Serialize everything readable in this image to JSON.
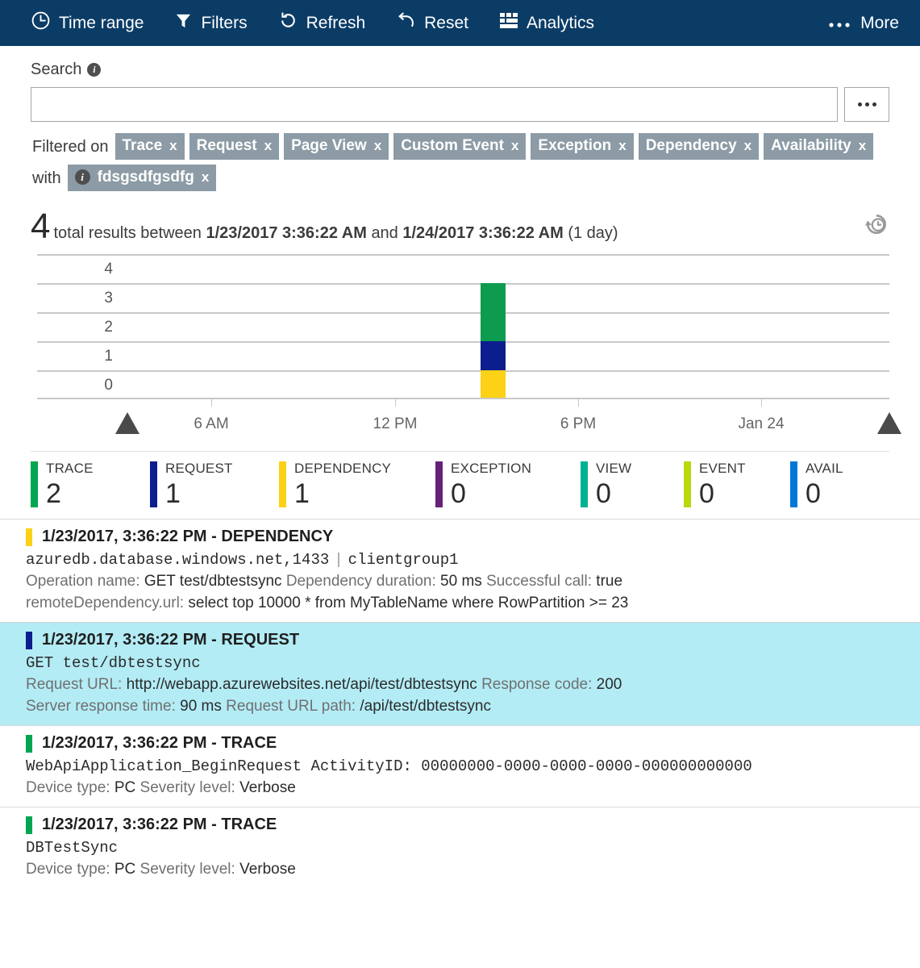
{
  "toolbar": {
    "items": [
      {
        "label": "Time range",
        "icon": "clock-icon"
      },
      {
        "label": "Filters",
        "icon": "funnel-icon"
      },
      {
        "label": "Refresh",
        "icon": "refresh-icon"
      },
      {
        "label": "Reset",
        "icon": "reset-icon"
      },
      {
        "label": "Analytics",
        "icon": "analytics-grid-icon"
      }
    ],
    "more_label": "More",
    "background": "#0B3C66"
  },
  "search": {
    "label": "Search",
    "info_glyph": "i",
    "value": "",
    "placeholder": "",
    "more_button": "..."
  },
  "filters": {
    "prefix": "Filtered on",
    "conjunction": "with",
    "chips": [
      {
        "label": "Trace",
        "x": "x"
      },
      {
        "label": "Request",
        "x": "x"
      },
      {
        "label": "Page View",
        "x": "x"
      },
      {
        "label": "Custom Event",
        "x": "x"
      },
      {
        "label": "Exception",
        "x": "x"
      },
      {
        "label": "Dependency",
        "x": "x"
      },
      {
        "label": "Availability",
        "x": "x"
      }
    ],
    "term_chip": {
      "label": "fdsgsdfgsdfg",
      "x": "x",
      "info_glyph": "i"
    },
    "chip_color": "#8C9BA5"
  },
  "summary": {
    "count": "4",
    "text_before": "total results between",
    "start": "1/23/2017 3:36:22 AM",
    "text_middle": "and",
    "end": "1/24/2017 3:36:22 AM",
    "duration": "(1 day)",
    "history_icon": "history-clock-icon"
  },
  "chart_data": {
    "type": "bar",
    "title": "",
    "xlabel": "",
    "ylabel": "",
    "ylim": [
      0,
      4
    ],
    "yticks": [
      "0",
      "1",
      "2",
      "3",
      "4"
    ],
    "grid": true,
    "legend": "bottom",
    "xticks": [
      "6 AM",
      "12 PM",
      "6 PM",
      "Jan 24"
    ],
    "x_range_start": "1/23/2017 3:36:22 AM",
    "x_range_end": "1/24/2017 3:36:22 AM",
    "stacked": true,
    "categories": [
      "3 PM"
    ],
    "series": [
      {
        "name": "DEPENDENCY",
        "values": [
          1
        ],
        "color": "#FCD116"
      },
      {
        "name": "REQUEST",
        "values": [
          1
        ],
        "color": "#0C1D8E"
      },
      {
        "name": "TRACE",
        "values": [
          2
        ],
        "color": "#0D9B4F"
      }
    ]
  },
  "legend": {
    "items": [
      {
        "name": "TRACE",
        "value": "2",
        "color": "#00A651"
      },
      {
        "name": "REQUEST",
        "value": "1",
        "color": "#0C1D8E"
      },
      {
        "name": "DEPENDENCY",
        "value": "1",
        "color": "#FCD116"
      },
      {
        "name": "EXCEPTION",
        "value": "0",
        "color": "#68217A"
      },
      {
        "name": "VIEW",
        "value": "0",
        "color": "#00B294"
      },
      {
        "name": "EVENT",
        "value": "0",
        "color": "#BAD80A"
      },
      {
        "name": "AVAIL",
        "value": "0",
        "color": "#0078D7"
      }
    ]
  },
  "results": [
    {
      "title": "1/23/2017, 3:36:22 PM - DEPENDENCY",
      "color": "#FCD116",
      "selected": false,
      "mono_line": "azuredb.database.windows.net,1433",
      "mono_line2": "clientgroup1",
      "meta1_pairs": [
        {
          "k": "Operation name:",
          "v": "GET test/dbtestsync"
        },
        {
          "k": "Dependency duration:",
          "v": "50 ms"
        },
        {
          "k": "Successful call:",
          "v": "true"
        }
      ],
      "meta2_pairs": [
        {
          "k": "remoteDependency.url:",
          "v": "select top 10000 * from MyTableName where RowPartition >= 23"
        }
      ]
    },
    {
      "title": "1/23/2017, 3:36:22 PM - REQUEST",
      "color": "#0C1D8E",
      "selected": true,
      "mono_line": "GET test/dbtestsync",
      "mono_line2": "",
      "meta1_pairs": [
        {
          "k": "Request URL:",
          "v": "http://webapp.azurewebsites.net/api/test/dbtestsync"
        },
        {
          "k": "Response code:",
          "v": "200"
        }
      ],
      "meta2_pairs": [
        {
          "k": "Server response time:",
          "v": "90 ms"
        },
        {
          "k": "Request URL path:",
          "v": "/api/test/dbtestsync"
        }
      ]
    },
    {
      "title": "1/23/2017, 3:36:22 PM - TRACE",
      "color": "#00A651",
      "selected": false,
      "mono_line": "WebApiApplication_BeginRequest ActivityID: 00000000-0000-0000-0000-000000000000",
      "mono_line2": "",
      "meta1_pairs": [
        {
          "k": "Device type:",
          "v": "PC"
        },
        {
          "k": "Severity level:",
          "v": "Verbose"
        }
      ],
      "meta2_pairs": []
    },
    {
      "title": "1/23/2017, 3:36:22 PM - TRACE",
      "color": "#00A651",
      "selected": false,
      "mono_line": "DBTestSync",
      "mono_line2": "",
      "meta1_pairs": [
        {
          "k": "Device type:",
          "v": "PC"
        },
        {
          "k": "Severity level:",
          "v": "Verbose"
        }
      ],
      "meta2_pairs": []
    }
  ]
}
